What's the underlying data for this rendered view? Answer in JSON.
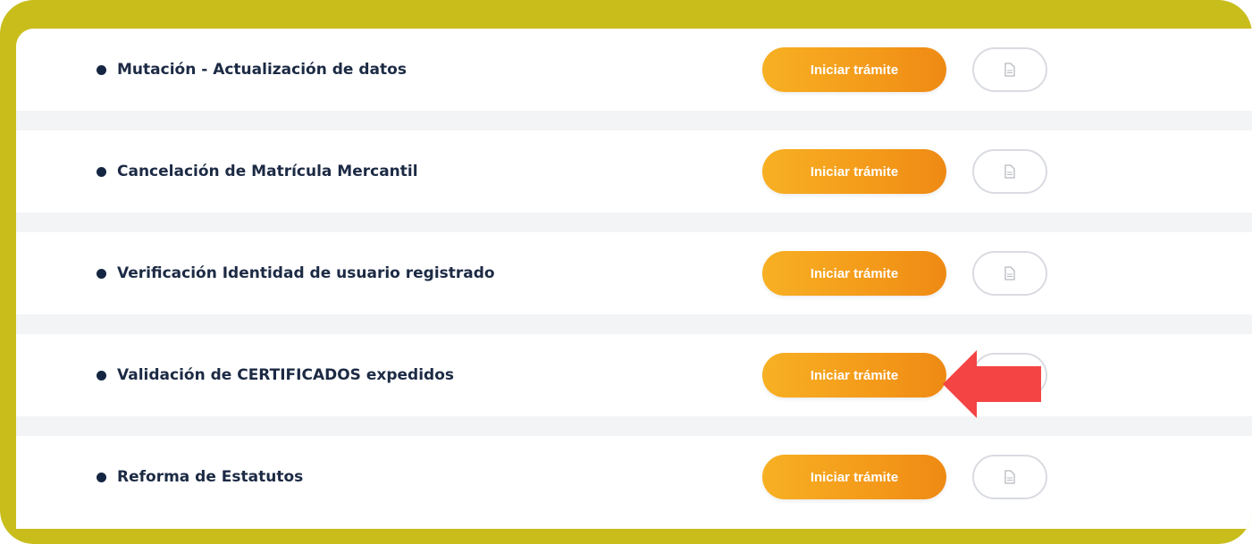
{
  "procedures": [
    {
      "label": "Mutación - Actualización de datos",
      "button": "Iniciar trámite",
      "doc_icon": "document-icon"
    },
    {
      "label": "Cancelación de Matrícula Mercantil",
      "button": "Iniciar trámite",
      "doc_icon": "document-icon"
    },
    {
      "label": "Verificación Identidad de usuario registrado",
      "button": "Iniciar trámite",
      "doc_icon": "document-icon"
    },
    {
      "label": "Validación de CERTIFICADOS expedidos",
      "button": "Iniciar trámite",
      "doc_icon": "document-icon"
    },
    {
      "label": "Reforma de Estatutos",
      "button": "Iniciar trámite",
      "doc_icon": "document-icon"
    }
  ],
  "colors": {
    "frame": "#c9bd1c",
    "button_orange": "#f49a1a",
    "label_text": "#1c2a44",
    "arrow": "#f44444"
  },
  "annotation": {
    "icon": "red-arrow-left-icon"
  }
}
